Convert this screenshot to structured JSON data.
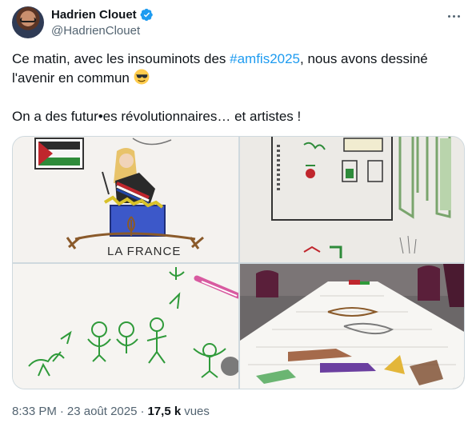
{
  "author": {
    "name": "Hadrien Clouet",
    "handle": "@HadrienClouet",
    "verified": true,
    "verified_color": "#1d9bf0"
  },
  "tweet": {
    "line1_before": "Ce matin, avec les insouminots des ",
    "hashtag": "#amfis2025",
    "line1_after": ", nous avons dessiné",
    "line2": "l'avenir en commun ",
    "emoji": "smiling-face-with-sunglasses",
    "line3": "On a des futur•es révolutionnaires… et artistes !"
  },
  "media": {
    "images": [
      {
        "name": "drawing-woman-at-podium",
        "caption": "LA FRANCE"
      },
      {
        "name": "drawing-building-plan"
      },
      {
        "name": "drawing-green-figures"
      },
      {
        "name": "table-covered-with-drawings"
      }
    ]
  },
  "meta": {
    "time": "8:33 PM",
    "separator": "·",
    "date": "23 août 2025",
    "views_count": "17,5 k",
    "views_label": "vues"
  },
  "colors": {
    "text": "#0f1419",
    "secondary": "#536471",
    "link": "#1d9bf0",
    "border": "#cfd9de"
  }
}
